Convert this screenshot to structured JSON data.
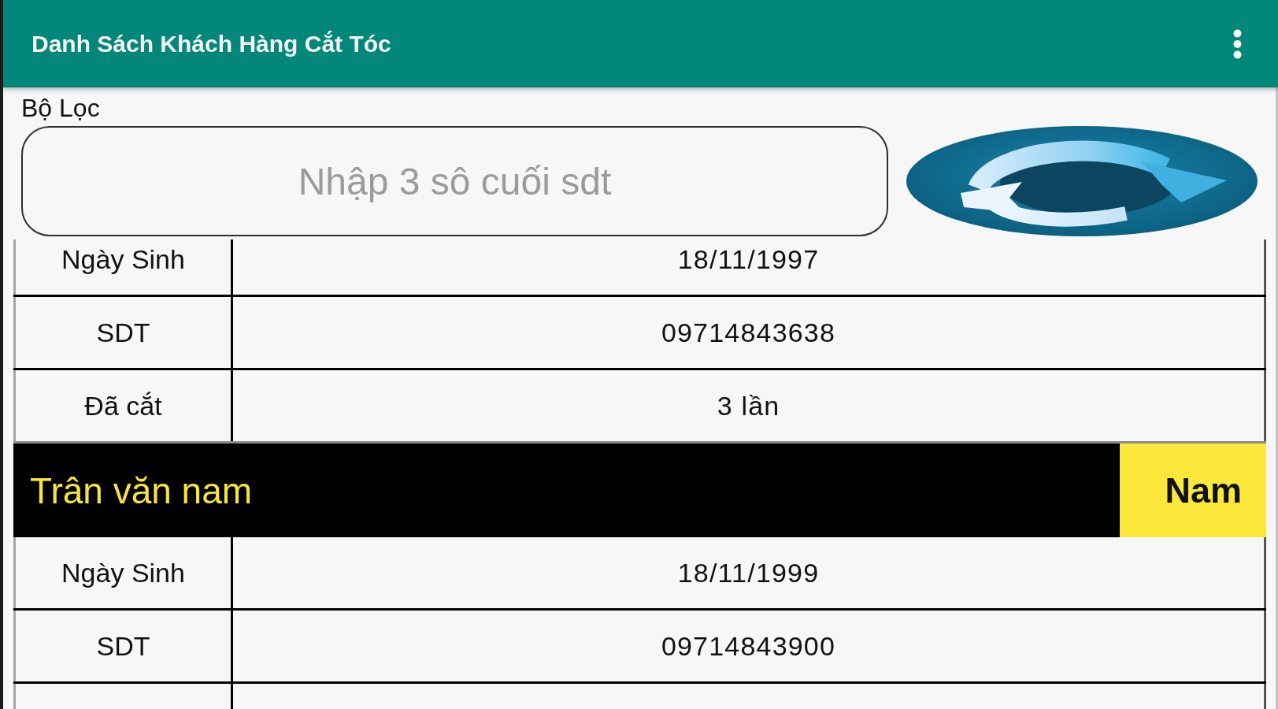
{
  "app_bar": {
    "title": "Danh Sách Khách Hàng Cắt Tóc"
  },
  "filter": {
    "label": "Bộ Lọc",
    "placeholder": "Nhập 3 sô cuối sdt"
  },
  "customers": [
    {
      "fields": [
        {
          "label": "Ngày Sinh",
          "value": "18/11/1997"
        },
        {
          "label": "SDT",
          "value": "09714843638"
        },
        {
          "label": "Đã cắt",
          "value": "3 lần"
        }
      ]
    },
    {
      "name": "Trân văn nam",
      "gender": "Nam",
      "fields": [
        {
          "label": "Ngày Sinh",
          "value": "18/11/1999"
        },
        {
          "label": "SDT",
          "value": "09714843900"
        }
      ]
    }
  ]
}
